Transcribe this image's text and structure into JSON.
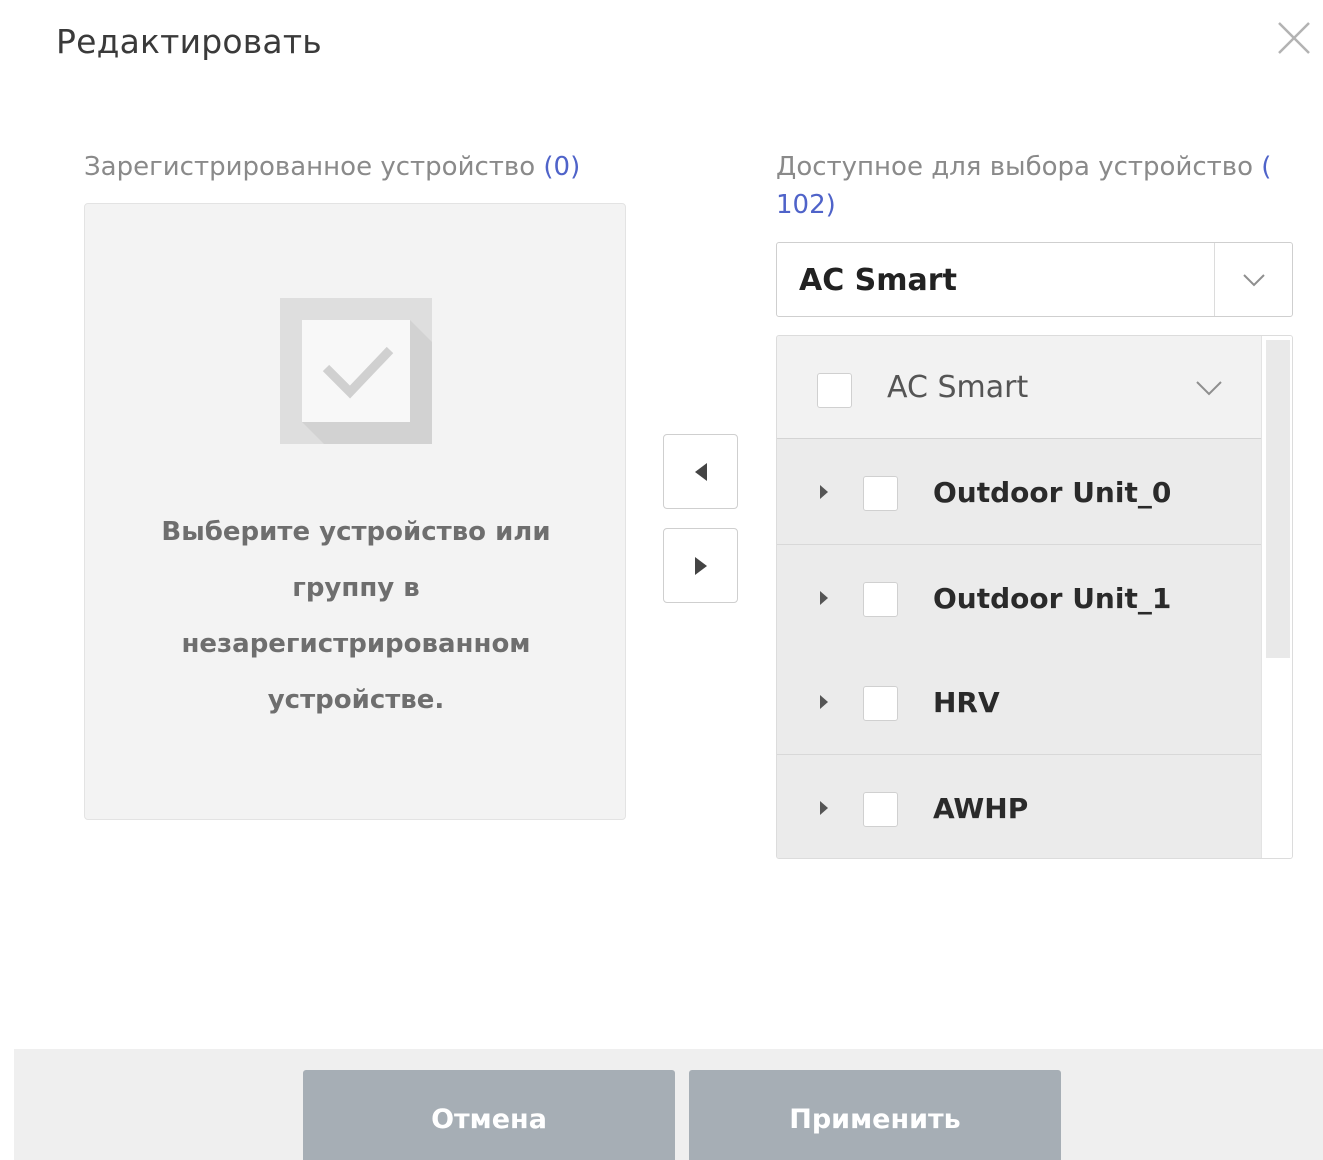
{
  "dialog": {
    "title": "Редактировать"
  },
  "registered": {
    "label": "Зарегистрированное устройство",
    "count": "(0)",
    "empty_message": "Выберите устройство или группу в незарегистрированном устройстве."
  },
  "available": {
    "label": "Доступное для выбора устройство",
    "count": "( 102)",
    "select_value": "AC Smart",
    "header_label": "AC Smart",
    "items": [
      {
        "label": "Outdoor Unit_0"
      },
      {
        "label": "Outdoor Unit_1"
      },
      {
        "label": "HRV"
      },
      {
        "label": "AWHP"
      }
    ]
  },
  "footer": {
    "cancel_label": "Отмена",
    "apply_label": "Применить"
  },
  "icons": {
    "close": "close-icon",
    "empty_state": "checkbox-check-icon",
    "move_left": "caret-left-icon",
    "move_right": "caret-right-icon",
    "dropdown": "chevron-down-icon",
    "expander": "caret-right-icon"
  },
  "colors": {
    "accent_count": "#4f63c9",
    "button_bg": "#a6aeb5",
    "footer_bg": "#efefef"
  }
}
